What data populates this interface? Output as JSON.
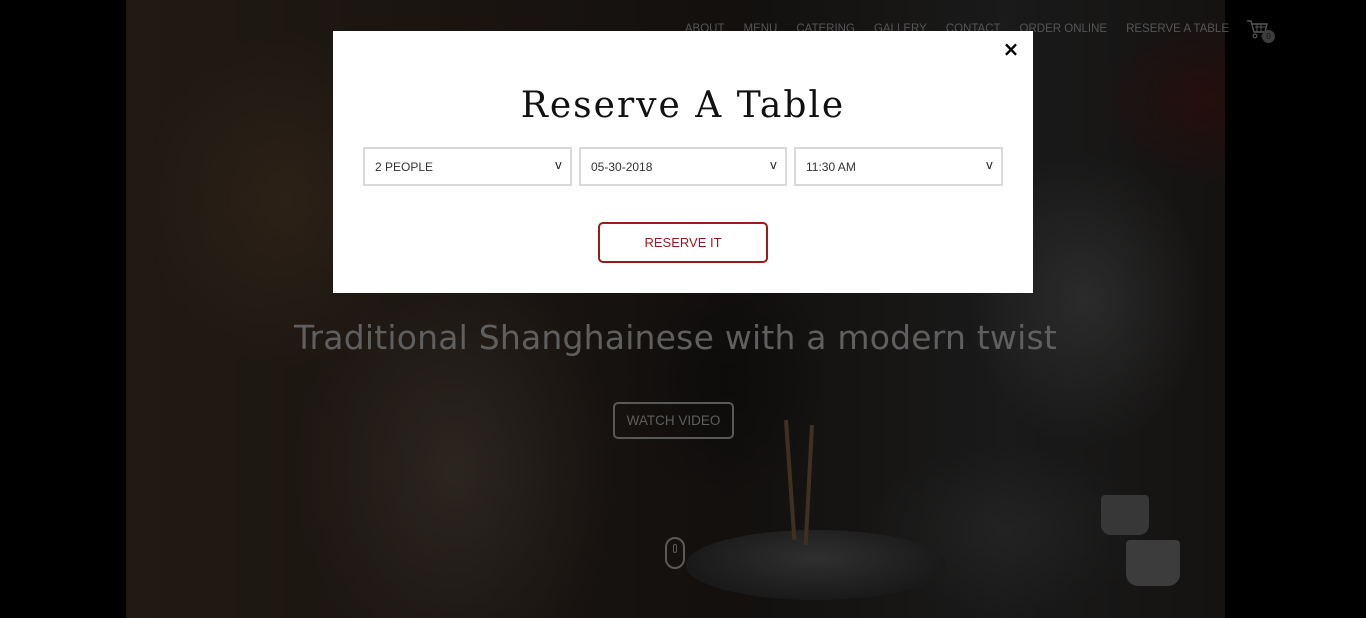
{
  "nav": {
    "items": [
      "ABOUT",
      "MENU",
      "CATERING",
      "GALLERY",
      "CONTACT",
      "ORDER ONLINE",
      "RESERVE A TABLE"
    ],
    "cart_count": "0"
  },
  "hero": {
    "tagline": "Traditional Shanghainese with a modern twist",
    "watch_video_label": "WATCH VIDEO"
  },
  "modal": {
    "title": "Reserve A Table",
    "close_label": "×",
    "party_size": "2 PEOPLE",
    "date": "05-30-2018",
    "time": "11:30 AM",
    "dropdown_chevron": "v",
    "submit_label": "RESERVE IT"
  },
  "colors": {
    "accent": "#9b1a1a",
    "overlay": "#000000",
    "modal_bg": "#ffffff"
  },
  "icons": {
    "cart": "shopping-cart-icon",
    "close": "close-icon",
    "scroll": "mouse-scroll-icon",
    "dropdown": "chevron-down-icon"
  }
}
